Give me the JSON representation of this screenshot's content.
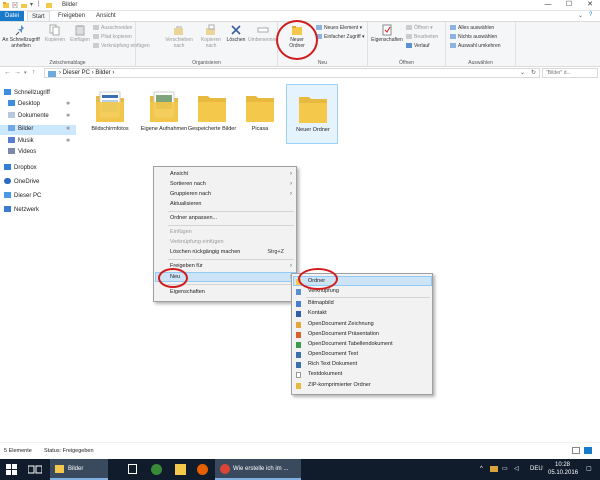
{
  "window": {
    "title": "Bilder",
    "min": "—",
    "max": "☐",
    "close": "✕"
  },
  "tabs": {
    "datei": "Datei",
    "start": "Start",
    "freigeben": "Freigeben",
    "ansicht": "Ansicht"
  },
  "ribbon": {
    "clipboard": {
      "pin": "An Schnellzugriff anheften",
      "copy": "Kopieren",
      "paste": "Einfügen",
      "cut": "Ausschneiden",
      "copy_path": "Pfad kopieren",
      "paste_link": "Verknüpfung einfügen",
      "label": "Zwischenablage"
    },
    "organize": {
      "move": "Verschieben nach",
      "copyto": "Kopieren nach",
      "delete": "Löschen",
      "rename": "Umbenennen",
      "label": "Organisieren"
    },
    "new": {
      "folder": "Neuer Ordner",
      "new_item": "Neues Element",
      "easy_access": "Einfacher Zugriff",
      "label": "Neu"
    },
    "open": {
      "props": "Eigenschaften",
      "open": "Öffnen",
      "edit": "Bearbeiten",
      "history": "Verlauf",
      "label": "Öffnen"
    },
    "select": {
      "all": "Alles auswählen",
      "none": "Nichts auswählen",
      "invert": "Auswahl umkehren",
      "label": "Auswählen"
    }
  },
  "address": {
    "path": "›  Dieser PC  ›  Bilder  ›",
    "search_placeholder": "\"Bilder\" d..."
  },
  "sidebar": {
    "items": [
      {
        "label": "Schnellzugriff"
      },
      {
        "label": "Desktop"
      },
      {
        "label": "Dokumente"
      },
      {
        "label": "Bilder"
      },
      {
        "label": "Musik"
      },
      {
        "label": "Videos"
      },
      {
        "label": "Dropbox"
      },
      {
        "label": "OneDrive"
      },
      {
        "label": "Dieser PC"
      },
      {
        "label": "Netzwerk"
      }
    ]
  },
  "files": [
    {
      "name": "Bildschirmfotos"
    },
    {
      "name": "Eigene Aufnahmen"
    },
    {
      "name": "Gespeicherte Bilder"
    },
    {
      "name": "Picasa"
    },
    {
      "name": "Neuer Ordner"
    }
  ],
  "context_menu": {
    "ansicht": "Ansicht",
    "sortieren": "Sortieren nach",
    "gruppieren": "Gruppieren nach",
    "aktualisieren": "Aktualisieren",
    "anpassen": "Ordner anpassen...",
    "einfuegen": "Einfügen",
    "verknuepfung_einfuegen": "Verknüpfung einfügen",
    "rueckgaengig": "Löschen rückgängig machen",
    "rueckgaengig_shortcut": "Strg+Z",
    "freigeben": "Freigeben für",
    "neu": "Neu",
    "eigenschaften": "Eigenschaften"
  },
  "submenu": {
    "items": [
      "Ordner",
      "Verknüpfung",
      "Bitmapbild",
      "Kontakt",
      "OpenDocument Zeichnung",
      "OpenDocument Präsentation",
      "OpenDocument Tabellendokument",
      "OpenDocument Text",
      "Rich Text Dokument",
      "Textdokument",
      "ZIP-komprimierter Ordner"
    ]
  },
  "statusbar": {
    "count": "5 Elemente",
    "state": "Status:  Freigegeben"
  },
  "taskbar": {
    "explorer_label": "Bilder",
    "chrome_label": "Wie erstelle ich im ...",
    "lang": "DEU",
    "time": "10:28",
    "date": "05.10.2016"
  },
  "colors": {
    "accent": "#1979ca",
    "highlight": "#cde4f7",
    "taskbar": "#101c2c",
    "annotation": "#d01c1c",
    "folder": "#f4c84a"
  }
}
